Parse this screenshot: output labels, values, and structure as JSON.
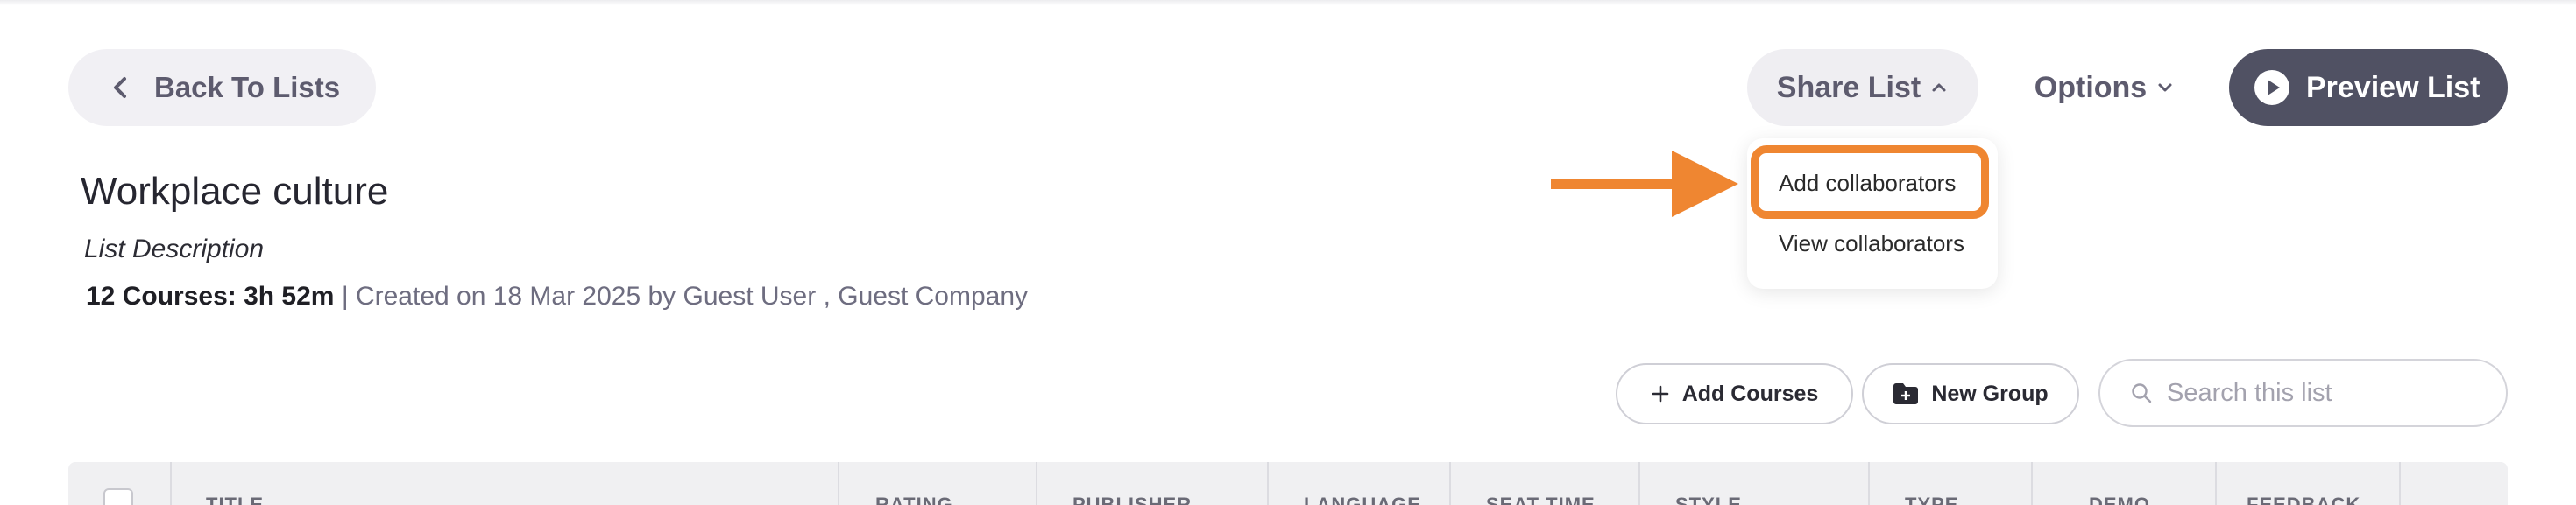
{
  "header": {
    "back_label": "Back To Lists",
    "share_label": "Share List",
    "options_label": "Options",
    "preview_label": "Preview List"
  },
  "share_menu": {
    "items": [
      "Add collaborators",
      "View collaborators"
    ],
    "highlighted": "Add collaborators"
  },
  "list": {
    "title": "Workplace culture",
    "description": "List Description",
    "summary": "12 Courses: 3h 52m",
    "separator": "|",
    "created": "Created on 18 Mar 2025 by Guest User , Guest Company"
  },
  "toolbar": {
    "add_courses_label": "Add Courses",
    "new_group_label": "New Group",
    "search_placeholder": "Search this list"
  },
  "table": {
    "columns": [
      "TITLE",
      "RATING",
      "PUBLISHER",
      "LANGUAGE",
      "SEAT TIME",
      "STYLE",
      "TYPE",
      "DEMO",
      "FEEDBACK"
    ]
  },
  "colors": {
    "accent_orange": "#ef8631",
    "preview_button_bg": "#505163",
    "pill_bg": "#f1f0f4",
    "muted_text": "#6e6d80"
  },
  "icons": [
    "chevron-left-icon",
    "chevron-up-icon",
    "chevron-down-icon",
    "play-icon",
    "plus-icon",
    "folder-plus-icon",
    "search-icon",
    "arrow-right-icon"
  ]
}
